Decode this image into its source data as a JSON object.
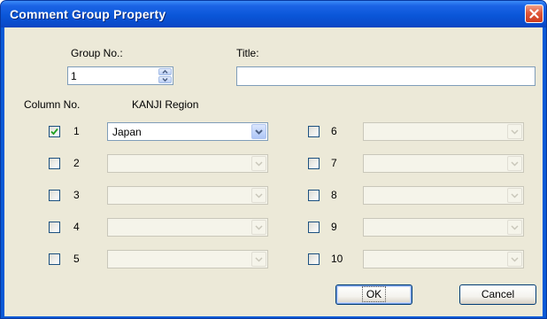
{
  "window": {
    "title": "Comment Group Property"
  },
  "group": {
    "group_no_label": "Group No.:",
    "group_no_value": "1",
    "title_label": "Title:",
    "title_value": ""
  },
  "columns": {
    "column_no_header": "Column No.",
    "kanji_region_header": "KANJI Region",
    "rows": [
      {
        "no": "1",
        "checked": true,
        "region": "Japan"
      },
      {
        "no": "2",
        "checked": false,
        "region": ""
      },
      {
        "no": "3",
        "checked": false,
        "region": ""
      },
      {
        "no": "4",
        "checked": false,
        "region": ""
      },
      {
        "no": "5",
        "checked": false,
        "region": ""
      },
      {
        "no": "6",
        "checked": false,
        "region": ""
      },
      {
        "no": "7",
        "checked": false,
        "region": ""
      },
      {
        "no": "8",
        "checked": false,
        "region": ""
      },
      {
        "no": "9",
        "checked": false,
        "region": ""
      },
      {
        "no": "10",
        "checked": false,
        "region": ""
      }
    ]
  },
  "buttons": {
    "ok": "OK",
    "cancel": "Cancel"
  },
  "icons": {
    "close": "close-icon",
    "spin_up": "spin-up-icon",
    "spin_down": "spin-down-icon",
    "dropdown": "chevron-down-icon",
    "check": "checkmark-icon"
  },
  "colors": {
    "title_bar": "#0a56d8",
    "dialog_face": "#ece9d8",
    "close_button": "#e0583a",
    "check_mark": "#21a121",
    "input_border": "#7f9db9"
  }
}
